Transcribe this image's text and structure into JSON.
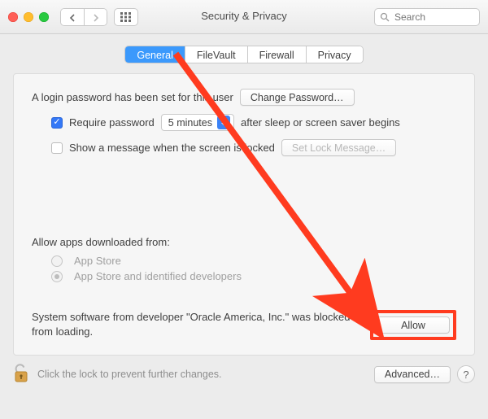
{
  "window": {
    "title": "Security & Privacy",
    "search_placeholder": "Search"
  },
  "tabs": {
    "general": "General",
    "filevault": "FileVault",
    "firewall": "Firewall",
    "privacy": "Privacy",
    "active": "general"
  },
  "login": {
    "password_set_msg": "A login password has been set for this user",
    "change_password_btn": "Change Password…",
    "require_password_label": "Require password",
    "require_password_checked": true,
    "delay_value": "5 minutes",
    "after_sleep_label": "after sleep or screen saver begins",
    "show_message_label": "Show a message when the screen is locked",
    "show_message_checked": false,
    "set_lock_msg_btn": "Set Lock Message…"
  },
  "downloads": {
    "heading": "Allow apps downloaded from:",
    "appstore_label": "App Store",
    "identified_label": "App Store and identified developers",
    "selected": "identified"
  },
  "blocked": {
    "message": "System software from developer \"Oracle America, Inc.\" was blocked from loading.",
    "allow_btn": "Allow"
  },
  "footer": {
    "lock_msg": "Click the lock to prevent further changes.",
    "advanced_btn": "Advanced…",
    "help": "?"
  },
  "annotation_color": "#ff3b1f"
}
